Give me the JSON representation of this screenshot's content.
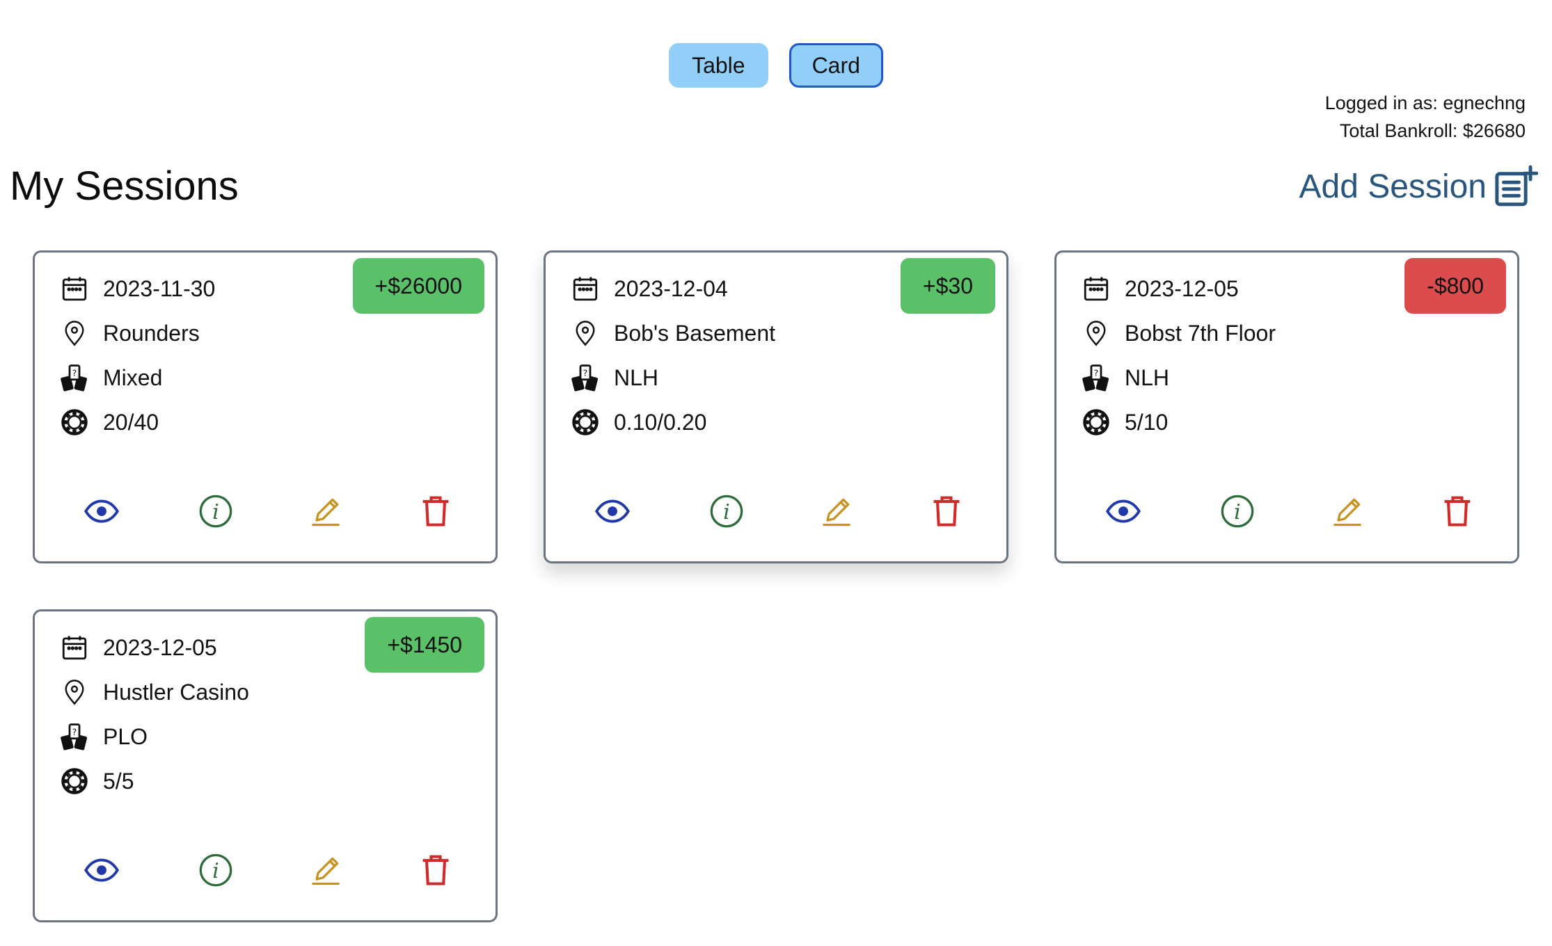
{
  "view_toggle": {
    "table_label": "Table",
    "card_label": "Card"
  },
  "user": {
    "logged_in": "Logged in as: egnechng",
    "bankroll": "Total Bankroll: $26680"
  },
  "page_title": "My Sessions",
  "add_session_label": "Add Session",
  "icons": {
    "date": "calendar-icon",
    "location": "location-pin-icon",
    "game": "playing-cards-icon",
    "stakes": "poker-chip-icon",
    "view": "eye-icon",
    "info": "info-icon",
    "edit": "pencil-icon",
    "delete": "trash-icon",
    "add": "add-note-icon"
  },
  "colors": {
    "positive": "#5bc169",
    "negative": "#dd4c4c",
    "view": "#2138a8",
    "info": "#2e6b3a",
    "edit": "#c8921e",
    "delete": "#d02b2b",
    "accent": "#27557e"
  },
  "sessions": [
    {
      "date": "2023-11-30",
      "location": "Rounders",
      "game": "Mixed",
      "stakes": "20/40",
      "result": "+$26000",
      "positive": true
    },
    {
      "date": "2023-12-04",
      "location": "Bob's Basement",
      "game": "NLH",
      "stakes": "0.10/0.20",
      "result": "+$30",
      "positive": true
    },
    {
      "date": "2023-12-05",
      "location": "Bobst 7th Floor",
      "game": "NLH",
      "stakes": "5/10",
      "result": "-$800",
      "positive": false
    },
    {
      "date": "2023-12-05",
      "location": "Hustler Casino",
      "game": "PLO",
      "stakes": "5/5",
      "result": "+$1450",
      "positive": true
    }
  ]
}
